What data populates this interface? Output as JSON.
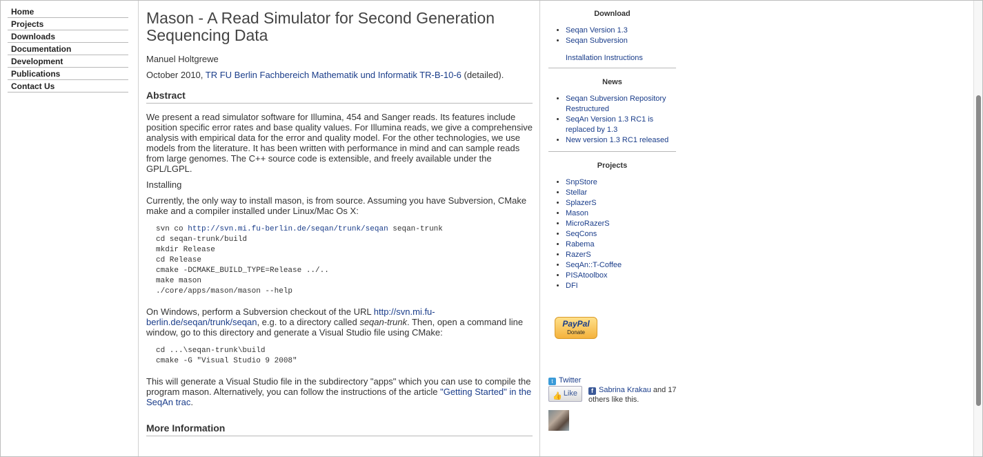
{
  "nav": {
    "items": [
      "Home",
      "Projects",
      "Downloads",
      "Documentation",
      "Development",
      "Publications",
      "Contact Us"
    ]
  },
  "main": {
    "title": "Mason - A Read Simulator for Second Generation Sequencing Data",
    "author": "Manuel Holtgrewe",
    "date_prefix": "October 2010,",
    "report_link": "TR FU Berlin Fachbereich Mathematik und Informatik TR-B-10-6",
    "report_suffix": "(detailed).",
    "abstract_heading": "Abstract",
    "abstract_text": "We present a read simulator software for Illumina, 454 and Sanger reads. Its features include position specific error rates and base quality values. For Illumina reads, we give a comprehensive analysis with empirical data for the error and quality model. For the other technologies, we use models from the literature. It has been written with performance in mind and can sample reads from large genomes. The C++ source code is extensible, and freely available under the GPL/LGPL.",
    "installing_label": "Installing",
    "install_intro": "Currently, the only way to install mason, is from source. Assuming you have Subversion, CMake make and a compiler installed under Linux/Mac Os X:",
    "code1": {
      "svn_prefix": "svn co ",
      "svn_url": "http://svn.mi.fu-berlin.de/seqan/trunk/seqan",
      "svn_suffix": " seqan-trunk",
      "lines": [
        "cd seqan-trunk/build",
        "mkdir Release",
        "cd Release",
        "cmake -DCMAKE_BUILD_TYPE=Release ../..",
        "make mason",
        "./core/apps/mason/mason --help"
      ]
    },
    "windows_prefix": "On Windows, perform a Subversion checkout of the URL",
    "windows_url": "http://svn.mi.fu-berlin.de/seqan/trunk/seqan",
    "windows_mid": ", e.g. to a directory called",
    "windows_dir": "seqan-trunk",
    "windows_suffix": ". Then, open a command line window, go to this directory and generate a Visual Studio file using CMake:",
    "code2": [
      "cd ...\\seqan-trunk\\build",
      "cmake -G \"Visual Studio 9 2008\""
    ],
    "vs_text": "This will generate a Visual Studio file in the subdirectory \"apps\" which you can use to compile the program mason. Alternatively, you can follow the instructions of the article",
    "vs_link": "\"Getting Started\" in the SeqAn trac",
    "vs_suffix": ".",
    "more_info_heading": "More Information"
  },
  "sidebar": {
    "download_heading": "Download",
    "download_links": [
      "Seqan Version 1.3",
      "Seqan Subversion"
    ],
    "install_link": "Installation Instructions",
    "news_heading": "News",
    "news_links": [
      "Seqan Subversion Repository Restructured",
      "SeqAn Version 1.3 RC1 is replaced by 1.3",
      "New version 1.3 RC1 released"
    ],
    "projects_heading": "Projects",
    "project_links": [
      "SnpStore",
      "Stellar",
      "SplazerS",
      "Mason",
      "MicroRazerS",
      "SeqCons",
      "Rabema",
      "RazerS",
      "SeqAn::T-Coffee",
      "PISAtoolbox",
      "DFI"
    ],
    "paypal_logo": "PayPal",
    "paypal_donate": "Donate",
    "twitter_label": "Twitter",
    "like_label": "Like",
    "like_person": "Sabrina Krakau",
    "like_text": " and 17 others like this."
  },
  "icons": [
    "twitter-icon",
    "facebook-icon",
    "thumbs-up-icon",
    "paypal-logo"
  ],
  "colors": {
    "link": "#1a3d8a",
    "text": "#333333",
    "divider": "#b8b8b8"
  }
}
